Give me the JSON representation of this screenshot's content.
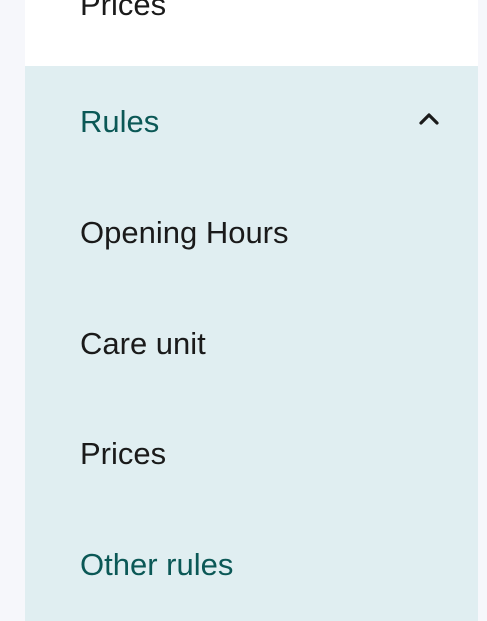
{
  "nav": {
    "previous_item_label": "Prices",
    "group": {
      "label": "Rules",
      "expanded": true,
      "toggle_icon": "chevron-up-icon",
      "items": [
        {
          "label": "Opening Hours"
        },
        {
          "label": "Care unit"
        },
        {
          "label": "Prices"
        },
        {
          "label": "Other rules"
        }
      ]
    }
  },
  "colors": {
    "page_background": "#f6f7fb",
    "panel_background": "#ffffff",
    "expanded_group_background": "#e0eef1",
    "accent_text": "#0b5856",
    "default_text": "#1a1a1a"
  }
}
